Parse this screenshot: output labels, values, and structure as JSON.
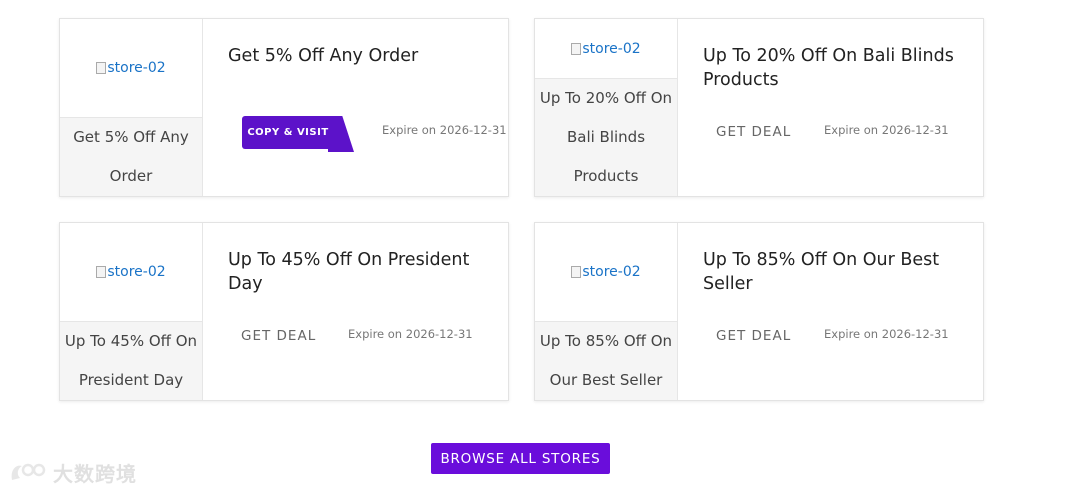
{
  "cards": [
    {
      "logo_alt": "store-02",
      "caption": "Get 5% Off Any Order",
      "title": "Get 5% Off Any Order",
      "action": "COPY & VISIT",
      "expire": "Expire on 2026-12-31"
    },
    {
      "logo_alt": "store-02",
      "caption": "Up To 20% Off On Bali Blinds Products",
      "title": "Up To 20% Off On Bali Blinds Products",
      "action": "GET DEAL",
      "expire": "Expire on 2026-12-31"
    },
    {
      "logo_alt": "store-02",
      "caption": "Up To 45% Off On President Day",
      "title": "Up To 45% Off On President Day",
      "action": "GET DEAL",
      "expire": "Expire on 2026-12-31"
    },
    {
      "logo_alt": "store-02",
      "caption": "Up To 85% Off On Our Best Seller",
      "title": "Up To 85% Off On Our Best Seller",
      "action": "GET DEAL",
      "expire": "Expire on 2026-12-31"
    }
  ],
  "browse_button": "BROWSE ALL STORES",
  "watermark": "大数跨境",
  "colors": {
    "accent": "#6a0ddb",
    "copy_button": "#5c12c9",
    "link": "#1a73c7"
  }
}
